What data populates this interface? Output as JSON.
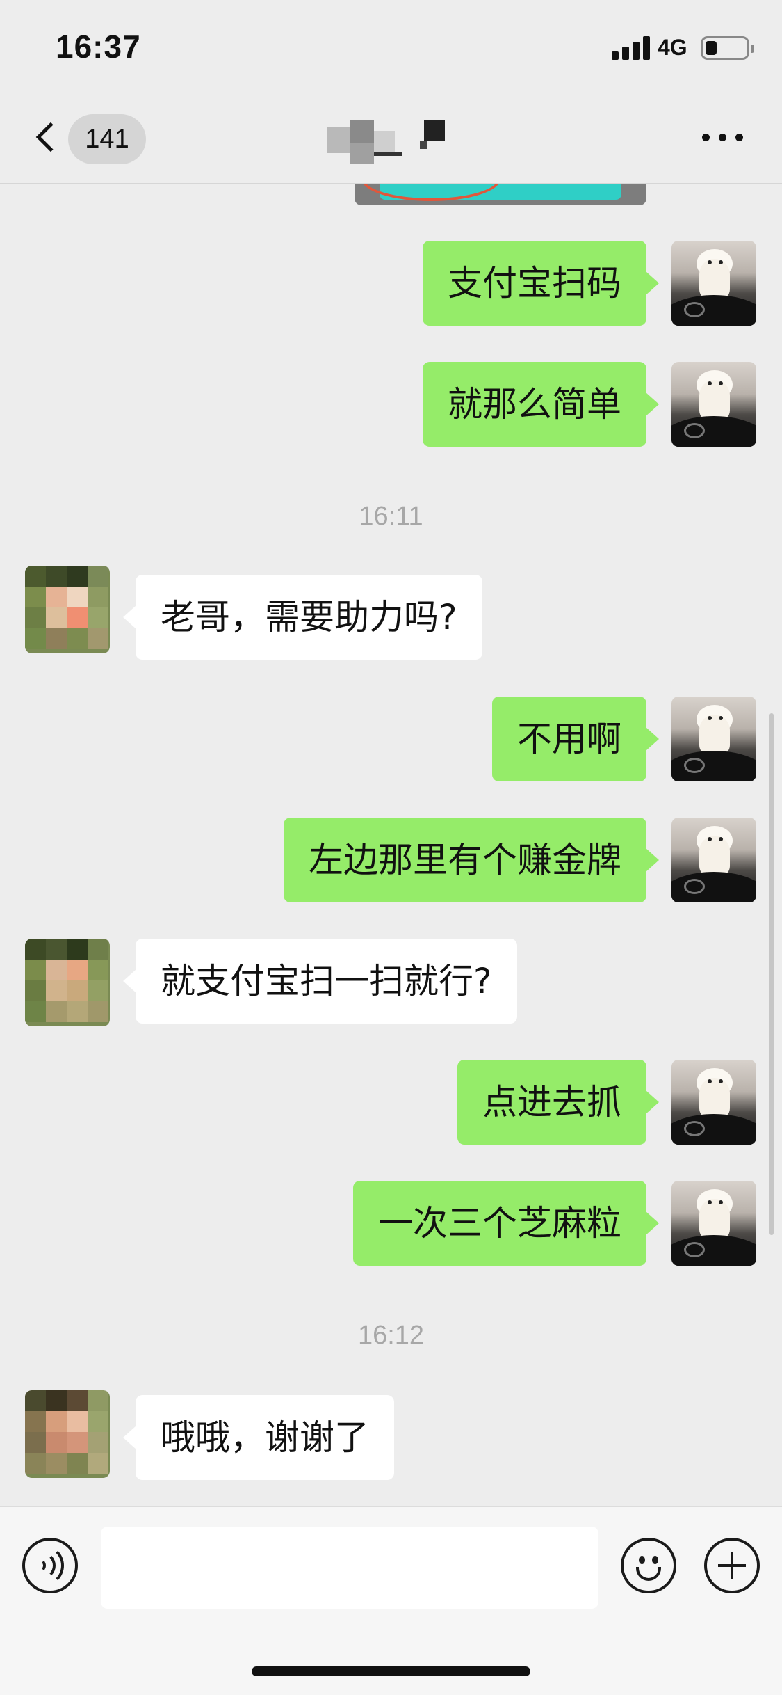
{
  "status_bar": {
    "time": "16:37",
    "network": "4G"
  },
  "nav": {
    "unread_count": "141"
  },
  "messages": [
    {
      "dir": "out",
      "text": "支付宝扫码"
    },
    {
      "dir": "out",
      "text": "就那么简单"
    },
    {
      "type": "time",
      "text": "16:11"
    },
    {
      "dir": "in",
      "text": "老哥，需要助力吗?"
    },
    {
      "dir": "out",
      "text": "不用啊"
    },
    {
      "dir": "out",
      "text": "左边那里有个赚金牌"
    },
    {
      "dir": "in",
      "text": "就支付宝扫一扫就行?"
    },
    {
      "dir": "out",
      "text": "点进去抓"
    },
    {
      "dir": "out",
      "text": "一次三个芝麻粒"
    },
    {
      "type": "time",
      "text": "16:12"
    },
    {
      "dir": "in",
      "text": "哦哦，谢谢了"
    }
  ],
  "input": {
    "value": ""
  },
  "colors": {
    "outgoing_bubble": "#95ec69",
    "incoming_bubble": "#ffffff",
    "background": "#ededed"
  },
  "icons": [
    "back-chevron-icon",
    "more-icon",
    "voice-icon",
    "emoji-icon",
    "plus-icon"
  ]
}
